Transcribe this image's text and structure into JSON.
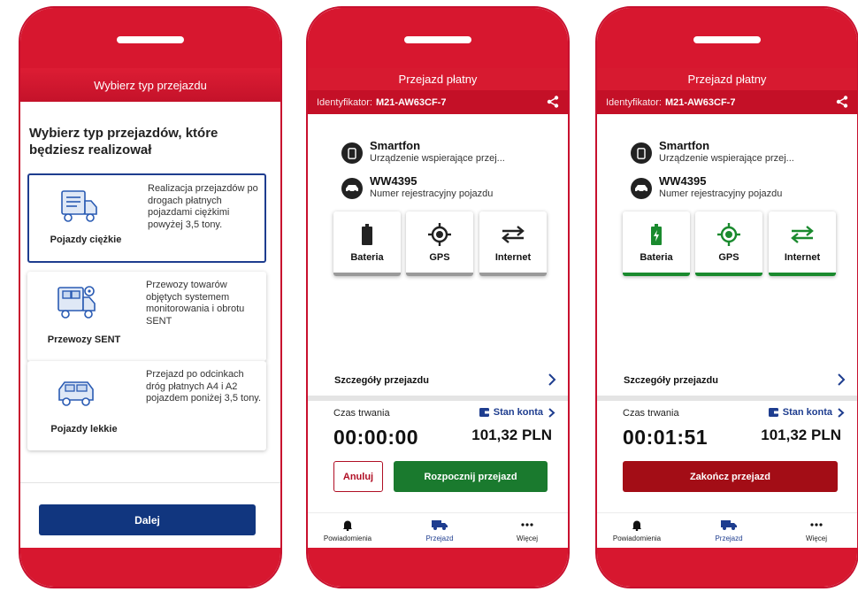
{
  "colors": {
    "brand_red": "#d7172f",
    "navy": "#11367f",
    "green": "#1a7a2e",
    "dark_red": "#a30d16",
    "status_gray": "#9a9a9a",
    "status_green": "#1a8a2e"
  },
  "phone1": {
    "header": "Wybierz typ przejazdu",
    "heading": "Wybierz typ przejazdów, które będziesz realizował",
    "cards": [
      {
        "name": "Pojazdy ciężkie",
        "icon": "heavy-truck-icon",
        "description": "Realizacja przejazdów po drogach płatnych pojazdami ciężkimi powyżej 3,5 tony.",
        "selected": true
      },
      {
        "name": "Przewozy SENT",
        "icon": "sent-truck-icon",
        "description": "Przewozy towarów objętych systemem monitorowania i obrotu SENT",
        "selected": false
      },
      {
        "name": "Pojazdy lekkie",
        "icon": "light-vehicle-icon",
        "description": "Przejazd po odcinkach dróg płatnych A4 i A2 pojazdem poniżej 3,5 tony.",
        "selected": false
      }
    ],
    "next_button": "Dalej"
  },
  "trip": {
    "title": "Przejazd płatny",
    "id_label": "Identyfikator:",
    "id_value": "M21-AW63CF-7",
    "device_title": "Smartfon",
    "device_subtitle": "Urządzenie wspierające przej...",
    "plate": "WW4395",
    "plate_subtitle": "Numer rejestracyjny pojazdu",
    "status_labels": {
      "battery": "Bateria",
      "gps": "GPS",
      "internet": "Internet"
    },
    "details_label": "Szczegóły przejazdu",
    "duration_label": "Czas trwania",
    "account_label": "Stan konta",
    "balance": "101,32 PLN",
    "tabs": {
      "notifications": "Powiadomienia",
      "trip": "Przejazd",
      "more": "Więcej"
    }
  },
  "phone2": {
    "timer": "00:00:00",
    "cancel_button": "Anuluj",
    "start_button": "Rozpocznij przejazd",
    "status_active": false
  },
  "phone3": {
    "timer": "00:01:51",
    "end_button": "Zakończ przejazd",
    "status_active": true
  }
}
